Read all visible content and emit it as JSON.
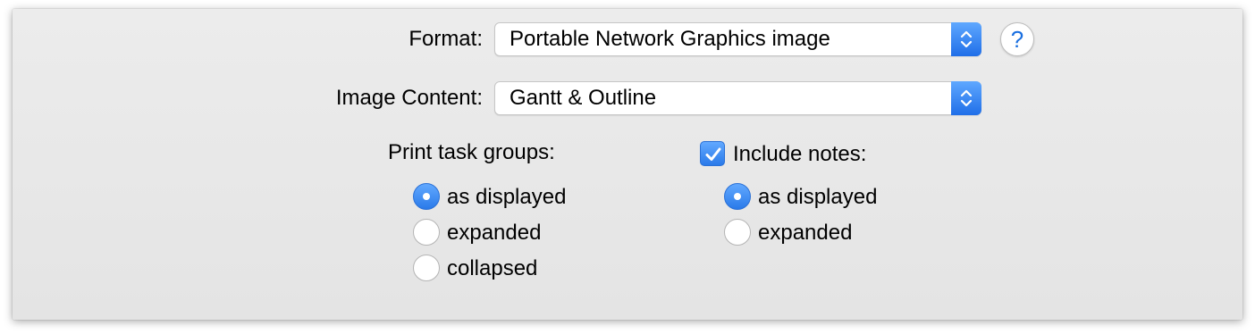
{
  "format": {
    "label": "Format:",
    "value": "Portable Network Graphics image",
    "icon": "chevron-up-down-icon"
  },
  "help": {
    "glyph": "?",
    "icon": "help-icon"
  },
  "image_content": {
    "label": "Image Content:",
    "value": "Gantt & Outline",
    "icon": "chevron-up-down-icon"
  },
  "task_groups": {
    "label": "Print task groups:",
    "options": [
      {
        "label": "as displayed",
        "selected": true
      },
      {
        "label": "expanded",
        "selected": false
      },
      {
        "label": "collapsed",
        "selected": false
      }
    ]
  },
  "notes": {
    "label": "Include notes:",
    "checked": true,
    "options": [
      {
        "label": "as displayed",
        "selected": true
      },
      {
        "label": "expanded",
        "selected": false
      }
    ]
  },
  "colors": {
    "accent": "#2a7ae9",
    "panel": "#e8e8e8"
  }
}
